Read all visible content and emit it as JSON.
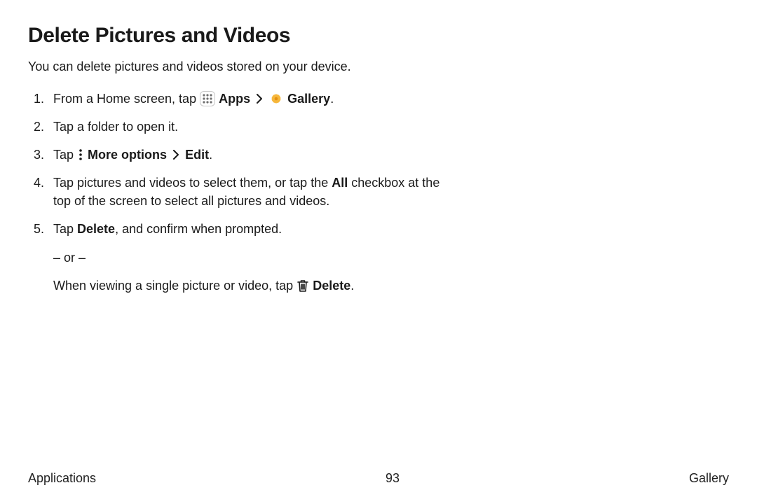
{
  "title": "Delete Pictures and Videos",
  "intro": "You can delete pictures and videos stored on your device.",
  "steps": {
    "s1_pre": "From a Home screen, tap ",
    "s1_apps": "Apps",
    "s1_gallery": "Gallery",
    "s2": "Tap a folder to open it.",
    "s3_pre": "Tap ",
    "s3_more": "More options",
    "s3_edit": "Edit",
    "s4_pre": "Tap pictures and videos to select them, or tap the ",
    "s4_all": "All",
    "s4_post": " checkbox at the top of the screen to select all pictures and videos.",
    "s5_pre": "Tap ",
    "s5_delete": "Delete",
    "s5_post": ", and confirm when prompted.",
    "s5_or": "– or –",
    "s5_alt_pre": "When viewing a single picture or video, tap ",
    "s5_alt_delete": "Delete",
    "s5_alt_post": "."
  },
  "footer": {
    "left": "Applications",
    "page": "93",
    "right": "Gallery"
  }
}
